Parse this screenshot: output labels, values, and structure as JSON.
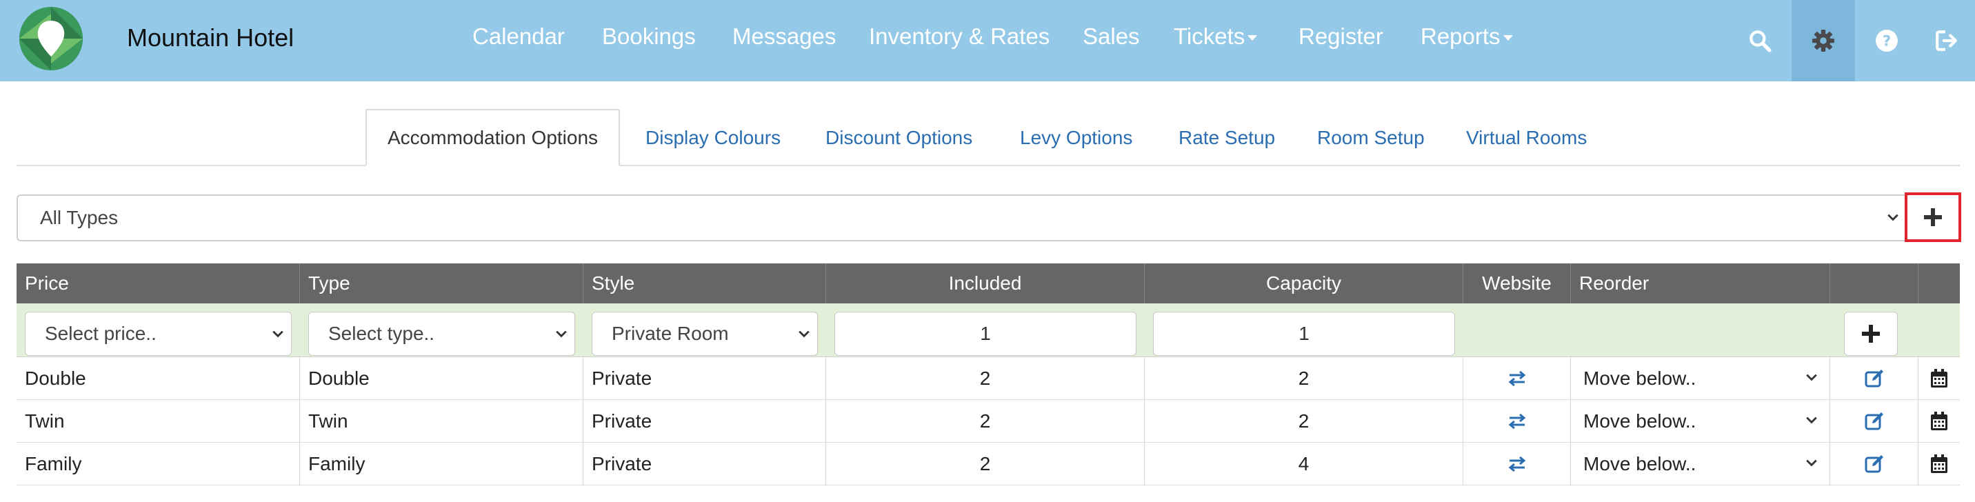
{
  "app": {
    "brand": "Mountain Hotel"
  },
  "nav": {
    "items": [
      {
        "label": "Calendar"
      },
      {
        "label": "Bookings"
      },
      {
        "label": "Messages"
      },
      {
        "label": "Inventory & Rates"
      },
      {
        "label": "Sales"
      },
      {
        "label": "Tickets"
      },
      {
        "label": "Register"
      },
      {
        "label": "Reports"
      }
    ],
    "icons": [
      "search-icon",
      "gear-icon",
      "help-icon",
      "logout-icon"
    ]
  },
  "tabs": [
    {
      "label": "Accommodation Options"
    },
    {
      "label": "Display Colours"
    },
    {
      "label": "Discount Options"
    },
    {
      "label": "Levy Options"
    },
    {
      "label": "Rate Setup"
    },
    {
      "label": "Room Setup"
    },
    {
      "label": "Virtual Rooms"
    }
  ],
  "filter": {
    "value": "All Types"
  },
  "table": {
    "headers": {
      "price": "Price",
      "type": "Type",
      "style": "Style",
      "included": "Included",
      "capacity": "Capacity",
      "website": "Website",
      "reorder": "Reorder"
    },
    "new_row": {
      "price_placeholder": "Select price..",
      "type_placeholder": "Select type..",
      "style_value": "Private Room",
      "included_value": "1",
      "capacity_value": "1"
    },
    "rows": [
      {
        "price": "Double",
        "type": "Double",
        "style": "Private",
        "included": "2",
        "capacity": "2",
        "reorder": "Move below.."
      },
      {
        "price": "Twin",
        "type": "Twin",
        "style": "Private",
        "included": "2",
        "capacity": "2",
        "reorder": "Move below.."
      },
      {
        "price": "Family",
        "type": "Family",
        "style": "Private",
        "included": "2",
        "capacity": "4",
        "reorder": "Move below.."
      }
    ]
  },
  "colors": {
    "navbar": "#95c9e8",
    "link": "#2a6db0",
    "header_row": "#666666",
    "new_row": "#e2efd9",
    "highlight": "#e0262c"
  }
}
